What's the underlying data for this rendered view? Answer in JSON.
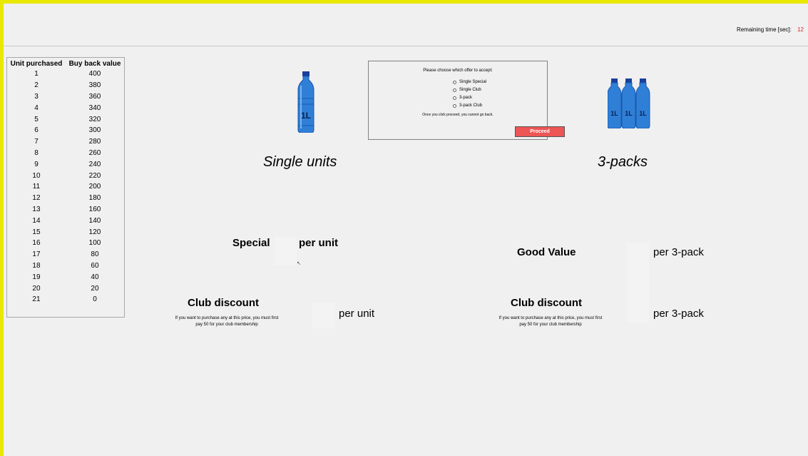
{
  "timer": {
    "label": "Remaining time [sec]:",
    "value": "12"
  },
  "buyback": {
    "headers": [
      "Unit purchased",
      "Buy back value"
    ],
    "rows": [
      [
        "1",
        "400"
      ],
      [
        "2",
        "380"
      ],
      [
        "3",
        "360"
      ],
      [
        "4",
        "340"
      ],
      [
        "5",
        "320"
      ],
      [
        "6",
        "300"
      ],
      [
        "7",
        "280"
      ],
      [
        "8",
        "260"
      ],
      [
        "9",
        "240"
      ],
      [
        "10",
        "220"
      ],
      [
        "11",
        "200"
      ],
      [
        "12",
        "180"
      ],
      [
        "13",
        "160"
      ],
      [
        "14",
        "140"
      ],
      [
        "15",
        "120"
      ],
      [
        "16",
        "100"
      ],
      [
        "17",
        "80"
      ],
      [
        "18",
        "60"
      ],
      [
        "19",
        "40"
      ],
      [
        "20",
        "20"
      ],
      [
        "21",
        "0"
      ]
    ]
  },
  "single": {
    "title": "Single units",
    "bottle_label": "1L",
    "special_label": "Special",
    "special_unit": "per unit",
    "club_label": "Club discount",
    "club_unit": "per unit",
    "club_note": "If you want to purchase any at this price, you must first pay 50 for your club membership"
  },
  "pack": {
    "title": "3-packs",
    "bottle_label": "1L",
    "value_label": "Good Value",
    "value_unit": "per 3-pack",
    "club_label": "Club discount",
    "club_unit": "per 3-pack",
    "club_note": "If you want to purchase any at this price, you must first pay 50 for your club membership"
  },
  "dialog": {
    "prompt": "Please choose which offer to accept:",
    "options": [
      "Single Special",
      "Single Club",
      "3-pack",
      "3-pack Club"
    ],
    "warning": "Once you click proceed, you cannot go back.",
    "proceed_label": "Proceed"
  },
  "colors": {
    "frame": "#e8e800",
    "proceed": "#ee5555",
    "timer_value": "#e02020",
    "bottle": "#2f7fd6"
  }
}
